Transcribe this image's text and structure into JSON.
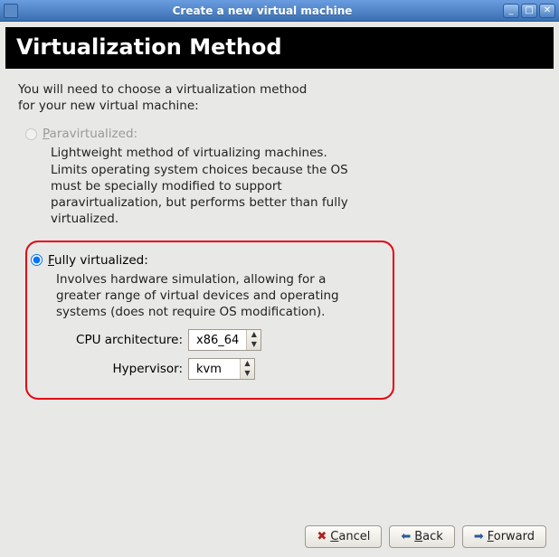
{
  "window": {
    "title": "Create a new virtual machine"
  },
  "page_heading": "Virtualization Method",
  "intro_line1": "You will need to choose a virtualization method",
  "intro_line2": "for your new virtual machine:",
  "options": {
    "paravirt": {
      "label": "Paravirtualized:",
      "underline_char": "P",
      "rest": "aravirtualized:",
      "checked": false,
      "enabled": false,
      "desc": "Lightweight method of virtualizing machines. Limits operating system choices because the OS must be specially modified to support paravirtualization, but performs better than fully virtualized."
    },
    "fullvirt": {
      "label": "Fully virtualized:",
      "underline_char": "F",
      "rest": "ully virtualized:",
      "checked": true,
      "enabled": true,
      "desc": "Involves hardware simulation, allowing for a greater range of virtual devices and operating systems (does not require OS modification).",
      "cpu_arch_label": "CPU architecture:",
      "cpu_arch_value": "x86_64",
      "hypervisor_label": "Hypervisor:",
      "hypervisor_value": "kvm"
    }
  },
  "buttons": {
    "cancel": "Cancel",
    "cancel_u": "C",
    "cancel_rest": "ancel",
    "back": "Back",
    "back_u": "B",
    "back_rest": "ack",
    "forward": "Forward",
    "forward_u": "F",
    "forward_rest": "orward"
  }
}
